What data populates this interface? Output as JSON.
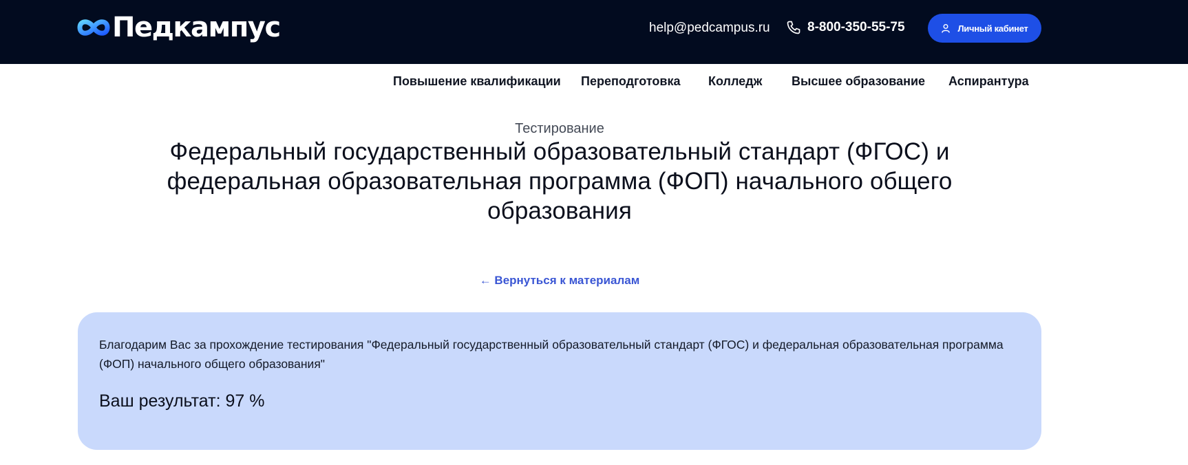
{
  "header": {
    "logo_text": "Педкампус",
    "logo_icon": "infinity-logo-icon",
    "email": "help@pedcampus.ru",
    "phone_icon": "phone-icon",
    "phone": "8-800-350-55-75",
    "cabinet_icon": "user-icon",
    "cabinet_label": "Личный кабинет",
    "background": "#020b1f",
    "accent": "#1e4fe6"
  },
  "nav": {
    "items": [
      {
        "label": "Повышение квалификации"
      },
      {
        "label": "Переподготовка"
      },
      {
        "label": "Колледж"
      },
      {
        "label": "Высшее образование"
      },
      {
        "label": "Аспирантура"
      }
    ]
  },
  "main": {
    "eyebrow": "Тестирование",
    "title": "Федеральный государственный образовательный стандарт (ФГОС) и федеральная образовательная программа (ФОП) начального общего образования",
    "back_link": "← Вернуться к материалам"
  },
  "result": {
    "thanks_text": "Благодарим Вас за прохождение тестирования \"Федеральный государственный образовательный стандарт (ФГОС) и федеральная образовательная программа (ФОП) начального общего образования\"",
    "score_text": "Ваш результат: 97 %",
    "card_color": "#c9d9fc"
  }
}
